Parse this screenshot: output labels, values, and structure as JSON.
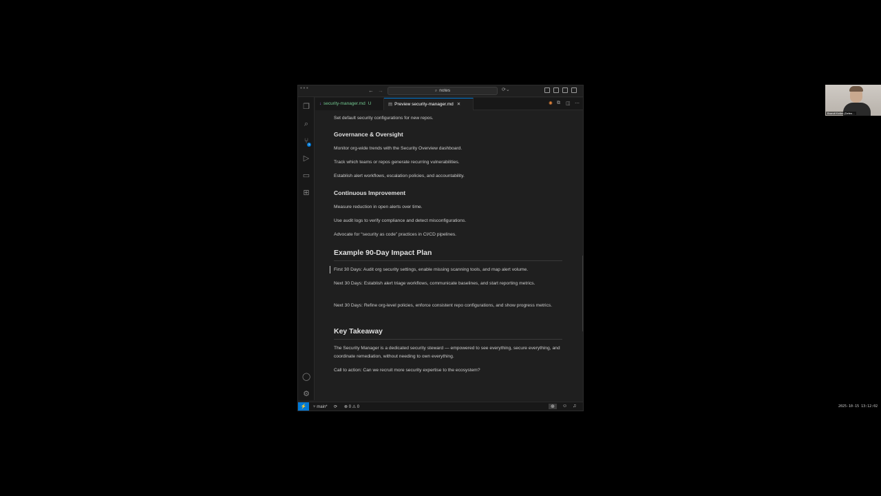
{
  "window": {
    "search_text": "notes"
  },
  "tabs": [
    {
      "label": "security-manager.md",
      "status": "U"
    },
    {
      "label": "Preview security-manager.md"
    }
  ],
  "doc": {
    "p_defaults": "Set default security configurations for new repos.",
    "h_governance": "Governance & Oversight",
    "p_monitor": "Monitor org-wide trends with the Security Overview dashboard.",
    "p_track": "Track which teams or repos generate recurring vulnerabilities.",
    "p_establish": "Establish alert workflows, escalation policies, and accountability.",
    "h_improvement": "Continuous Improvement",
    "p_measure": "Measure reduction in open alerts over time.",
    "p_audit": "Use audit logs to verify compliance and detect misconfigurations.",
    "p_advocate": "Advocate for “security as code” practices in CI/CD pipelines.",
    "h_plan": "Example 90-Day Impact Plan",
    "p_first30": "First 30 Days: Audit org security settings, enable missing scanning tools, and map alert volume.",
    "p_next30a": "Next 30 Days: Establish alert triage workflows, communicate baselines, and start reporting metrics.",
    "p_next30b": "Next 30 Days: Refine org-level policies, enforce consistent repo configurations, and show progress metrics.",
    "h_takeaway": "Key Takeaway",
    "p_steward": "The Security Manager is a dedicated security steward — empowered to see everything, secure everything, and coordinate remediation, without needing to own everything.",
    "p_cta": "Call to action: Can we recruit more security expertise to the ecosystem?"
  },
  "activity": {
    "scm_badge": "3"
  },
  "statusbar": {
    "branch": "main*",
    "errors": "0",
    "warnings": "0"
  },
  "webcam": {
    "name": "Brandt Keller (Defen..."
  },
  "timestamp": "2025-10-15 13:12:02",
  "colors": {
    "accent": "#0078d4",
    "untracked": "#73c991",
    "editor_bg": "#1f1f1f"
  }
}
